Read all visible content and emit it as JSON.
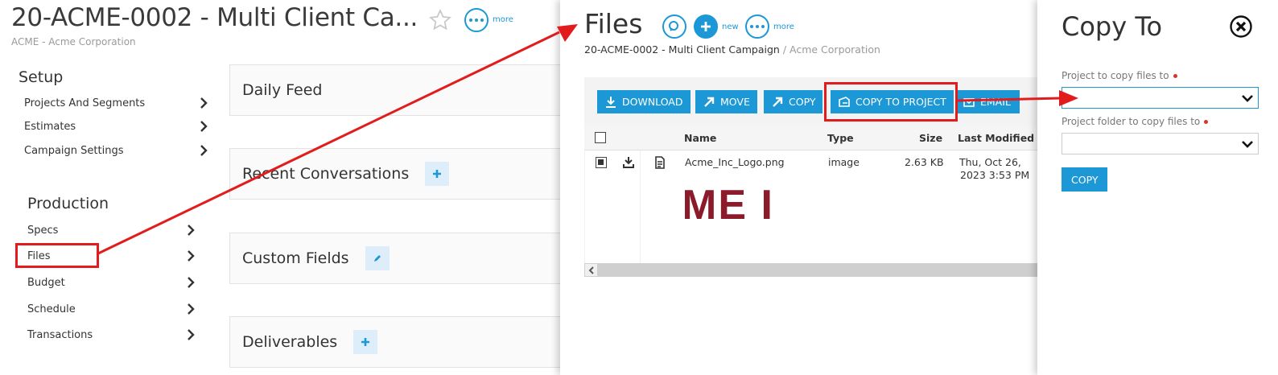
{
  "project": {
    "title": "20-ACME-0002 - Multi Client Ca...",
    "client": "ACME - Acme Corporation",
    "more_label": "more",
    "setup_heading": "Setup",
    "setup_items": [
      "Projects And Segments",
      "Estimates",
      "Campaign Settings"
    ],
    "production_heading": "Production",
    "production_items": [
      "Specs",
      "Files",
      "Budget",
      "Schedule",
      "Transactions"
    ],
    "cards": [
      "Daily Feed",
      "Recent Conversations",
      "Custom Fields",
      "Deliverables"
    ]
  },
  "files": {
    "title": "Files",
    "new_label": "new",
    "more_label": "more",
    "breadcrumb_project": "20-ACME-0002 - Multi Client Campaign",
    "breadcrumb_sep": " / ",
    "breadcrumb_client": "Acme Corporation",
    "toolbar": {
      "download": "DOWNLOAD",
      "move": "MOVE",
      "copy": "COPY",
      "copy_to_project": "COPY TO PROJECT",
      "email": "EMAIL"
    },
    "columns": {
      "name": "Name",
      "type": "Type",
      "size": "Size",
      "last_modified": "Last Modified"
    },
    "rows": [
      {
        "name": "Acme_Inc_Logo.png",
        "type": "image",
        "size": "2.63 KB",
        "modified_line1": "Thu, Oct 26,",
        "modified_line2": "2023 3:53 PM",
        "thumb_text": "ME I"
      }
    ]
  },
  "copy_to": {
    "title": "Copy To",
    "project_label": "Project to copy files to",
    "project_value": "",
    "folder_label": "Project folder to copy files to",
    "folder_value": "",
    "button": "COPY"
  },
  "colors": {
    "accent": "#1c98d6",
    "highlight": "#e21c1c",
    "required": "#d9342b",
    "thumb_text": "#8b1a2b"
  },
  "icons": [
    "star-icon",
    "more-icon",
    "search-icon",
    "plus-icon",
    "chevron-right-icon",
    "download-icon",
    "arrow-up-right-icon",
    "copy-project-icon",
    "mail-icon",
    "file-icon",
    "close-icon",
    "chevron-down-icon",
    "chevron-left-icon"
  ]
}
